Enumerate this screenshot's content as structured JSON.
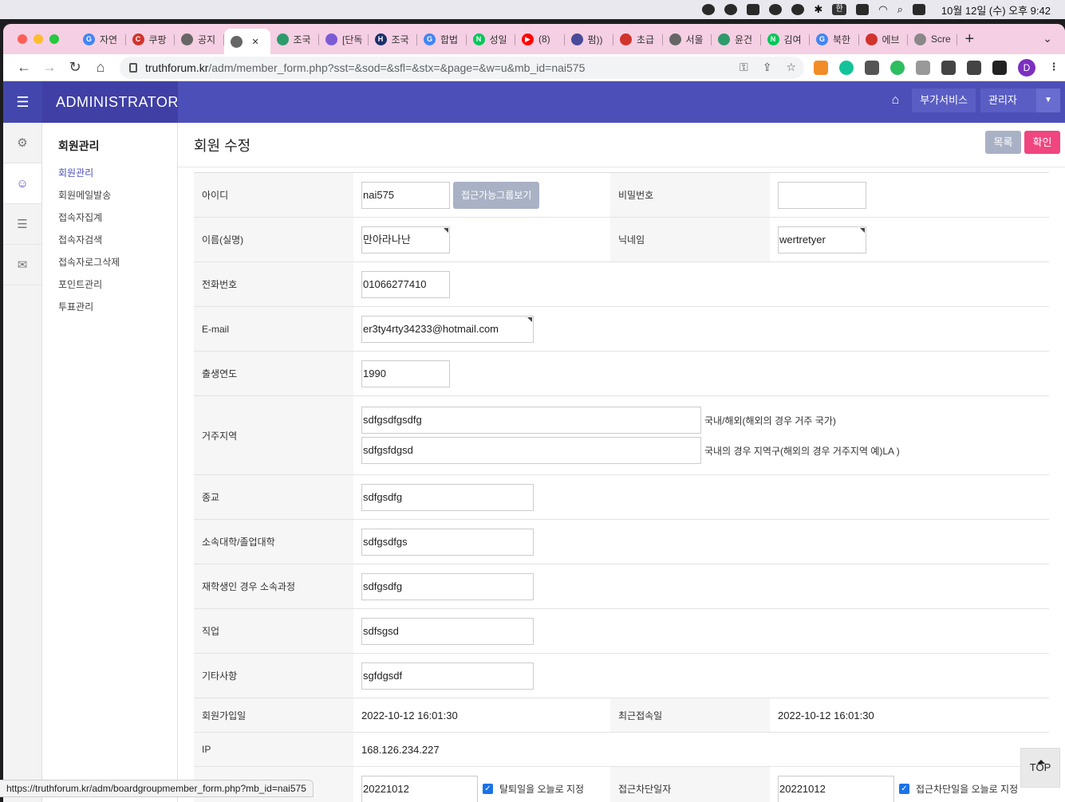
{
  "menubar": {
    "clock": "10월 12일 (수) 오후 9:42",
    "input_source": "한"
  },
  "browser": {
    "tabs": [
      {
        "label": "자연",
        "icon": "google-icon",
        "color": "#4285f4",
        "glyph": "G"
      },
      {
        "label": "쿠팡",
        "icon": "coupang-icon",
        "color": "#d0342c",
        "glyph": "C"
      },
      {
        "label": "공지",
        "icon": "globe-icon",
        "color": "#666666",
        "glyph": ""
      },
      {
        "label": "",
        "icon": "globe-icon",
        "color": "#666666",
        "glyph": ""
      },
      {
        "label": "조국",
        "icon": "chart-icon",
        "color": "#2e9b6b",
        "glyph": ""
      },
      {
        "label": "[단독",
        "icon": "daum-icon",
        "color": "#7b5bd6",
        "glyph": ""
      },
      {
        "label": "조국",
        "icon": "h-icon",
        "color": "#1b2f6b",
        "glyph": "H"
      },
      {
        "label": "합법",
        "icon": "google-icon",
        "color": "#4285f4",
        "glyph": "G"
      },
      {
        "label": "성일",
        "icon": "naver-icon",
        "color": "#03c75a",
        "glyph": "N"
      },
      {
        "label": "(8)",
        "icon": "youtube-icon",
        "color": "#ff0000",
        "glyph": "▶"
      },
      {
        "label": "펌))",
        "icon": "tw-icon",
        "color": "#4a4a9a",
        "glyph": ""
      },
      {
        "label": "초급",
        "icon": "alarm-icon",
        "color": "#d0342c",
        "glyph": ""
      },
      {
        "label": "서울",
        "icon": "globe-icon",
        "color": "#666666",
        "glyph": ""
      },
      {
        "label": "윤건",
        "icon": "chart-icon",
        "color": "#2e9b6b",
        "glyph": ""
      },
      {
        "label": "김여",
        "icon": "naver-icon",
        "color": "#03c75a",
        "glyph": "N"
      },
      {
        "label": "북한",
        "icon": "google-icon",
        "color": "#4285f4",
        "glyph": "G"
      },
      {
        "label": "에브",
        "icon": "alarm-icon",
        "color": "#d0342c",
        "glyph": ""
      },
      {
        "label": "Scre",
        "icon": "camera-icon",
        "color": "#888888",
        "glyph": ""
      }
    ],
    "url_host": "truthforum.kr",
    "url_path": "/adm/member_form.php?sst=&sod=&sfl=&stx=&page=&w=u&mb_id=nai575",
    "profile_initial": "D",
    "status_url": "https://truthforum.kr/adm/boardgroupmember_form.php?mb_id=nai575"
  },
  "app": {
    "brand": "ADMINISTRATOR",
    "services_label": "부가서비스",
    "admin_label": "관리자"
  },
  "submenu": {
    "title": "회원관리",
    "items": [
      "회원관리",
      "회원메일발송",
      "접속자집계",
      "접속자검색",
      "접속자로그삭제",
      "포인트관리",
      "투표관리"
    ]
  },
  "page": {
    "title": "회원 수정",
    "list_btn": "목록",
    "ok_btn": "확인",
    "top_btn": "TOP"
  },
  "form": {
    "id_label": "아이디",
    "id_value": "nai575",
    "group_btn": "접근가능그룹보기",
    "pw_label": "비밀번호",
    "pw_value": "",
    "name_label": "이름(실명)",
    "name_value": "만아라나난",
    "nick_label": "닉네임",
    "nick_value": "wertretyer",
    "phone_label": "전화번호",
    "phone_value": "01066277410",
    "email_label": "E-mail",
    "email_value": "er3ty4rty34233@hotmail.com",
    "birth_label": "출생연도",
    "birth_value": "1990",
    "region_label": "거주지역",
    "region1_value": "sdfgsdfgsdfg",
    "region1_hint": "국내/해외(해외의 경우 거주 국가)",
    "region2_value": "sdfgsfdgsd",
    "region2_hint": "국내의 경우 지역구(해외의 경우 거주지역 예)LA )",
    "religion_label": "종교",
    "religion_value": "sdfgsdfg",
    "univ_label": "소속대학/졸업대학",
    "univ_value": "sdfgsdfgs",
    "course_label": "재학생인 경우 소속과정",
    "course_value": "sdfgsdfg",
    "job_label": "직업",
    "job_value": "sdfsgsd",
    "etc_label": "기타사항",
    "etc_value": "sgfdgsdf",
    "joined_label": "회원가입일",
    "joined_value": "2022-10-12 16:01:30",
    "last_label": "최근접속일",
    "last_value": "2022-10-12 16:01:30",
    "ip_label": "IP",
    "ip_value": "168.126.234.227",
    "leave_value": "20221012",
    "leave_check_label": "탈퇴일을 오늘로 지정",
    "block_label": "접근차단일자",
    "block_value": "20221012",
    "block_check_label": "접근차단일을 오늘로 지정"
  }
}
